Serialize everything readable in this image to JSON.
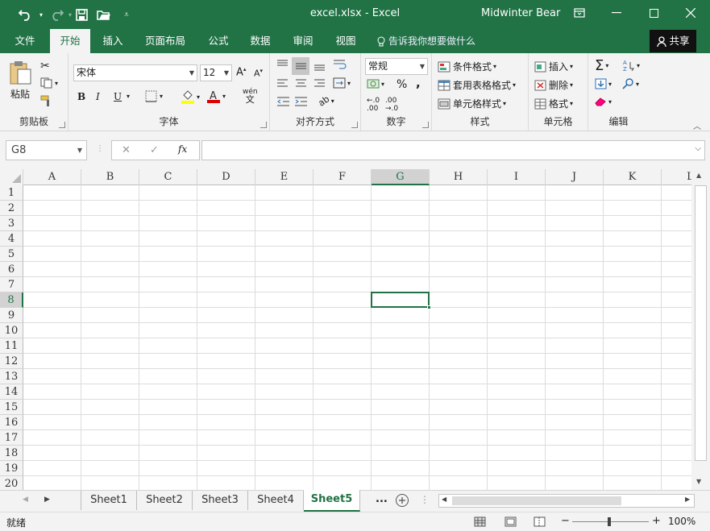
{
  "titlebar": {
    "title": "excel.xlsx  -  Excel",
    "user": "Midwinter Bear",
    "colors": {
      "brand": "#217346"
    }
  },
  "quick_access": {
    "undo_icon": "undo-icon",
    "redo_icon": "redo-icon",
    "save_icon": "save-icon",
    "open_icon": "open-folder-icon",
    "customize_icon": "customize-dropdown-icon"
  },
  "tabs": [
    {
      "label": "文件"
    },
    {
      "label": "开始"
    },
    {
      "label": "插入"
    },
    {
      "label": "页面布局"
    },
    {
      "label": "公式"
    },
    {
      "label": "数据"
    },
    {
      "label": "审阅"
    },
    {
      "label": "视图"
    }
  ],
  "tell_me": "告诉我你想要做什么",
  "share": "共享",
  "ribbon": {
    "clipboard": {
      "label": "剪贴板",
      "paste": "粘贴"
    },
    "font": {
      "label": "字体",
      "font_name": "宋体",
      "font_size": "12",
      "bold": "B",
      "italic": "I",
      "underline": "U",
      "phonetic": "wén"
    },
    "alignment": {
      "label": "对齐方式"
    },
    "number": {
      "label": "数字",
      "format": "常规",
      "percent": "%",
      "comma": ","
    },
    "styles": {
      "label": "样式",
      "conditional": "条件格式",
      "table_format": "套用表格格式",
      "cell_styles": "单元格样式"
    },
    "cells": {
      "label": "单元格",
      "insert": "插入",
      "delete": "删除",
      "format": "格式"
    },
    "editing": {
      "label": "编辑"
    }
  },
  "formula_bar": {
    "name_box": "G8",
    "fx": "fx",
    "value": ""
  },
  "grid": {
    "columns": [
      "A",
      "B",
      "C",
      "D",
      "E",
      "F",
      "G",
      "H",
      "I",
      "J",
      "K",
      "L"
    ],
    "rows": [
      "1",
      "2",
      "3",
      "4",
      "5",
      "6",
      "7",
      "8",
      "9",
      "10",
      "11",
      "12",
      "13",
      "14",
      "15",
      "16",
      "17",
      "18",
      "19",
      "20"
    ],
    "selected_column": "G",
    "selected_row": "8",
    "selected_cell": "G8"
  },
  "sheets": {
    "tabs": [
      "Sheet1",
      "Sheet2",
      "Sheet3",
      "Sheet4",
      "Sheet5"
    ],
    "more": "...",
    "active": "Sheet5"
  },
  "status": {
    "ready": "就绪",
    "zoom": "100%"
  }
}
